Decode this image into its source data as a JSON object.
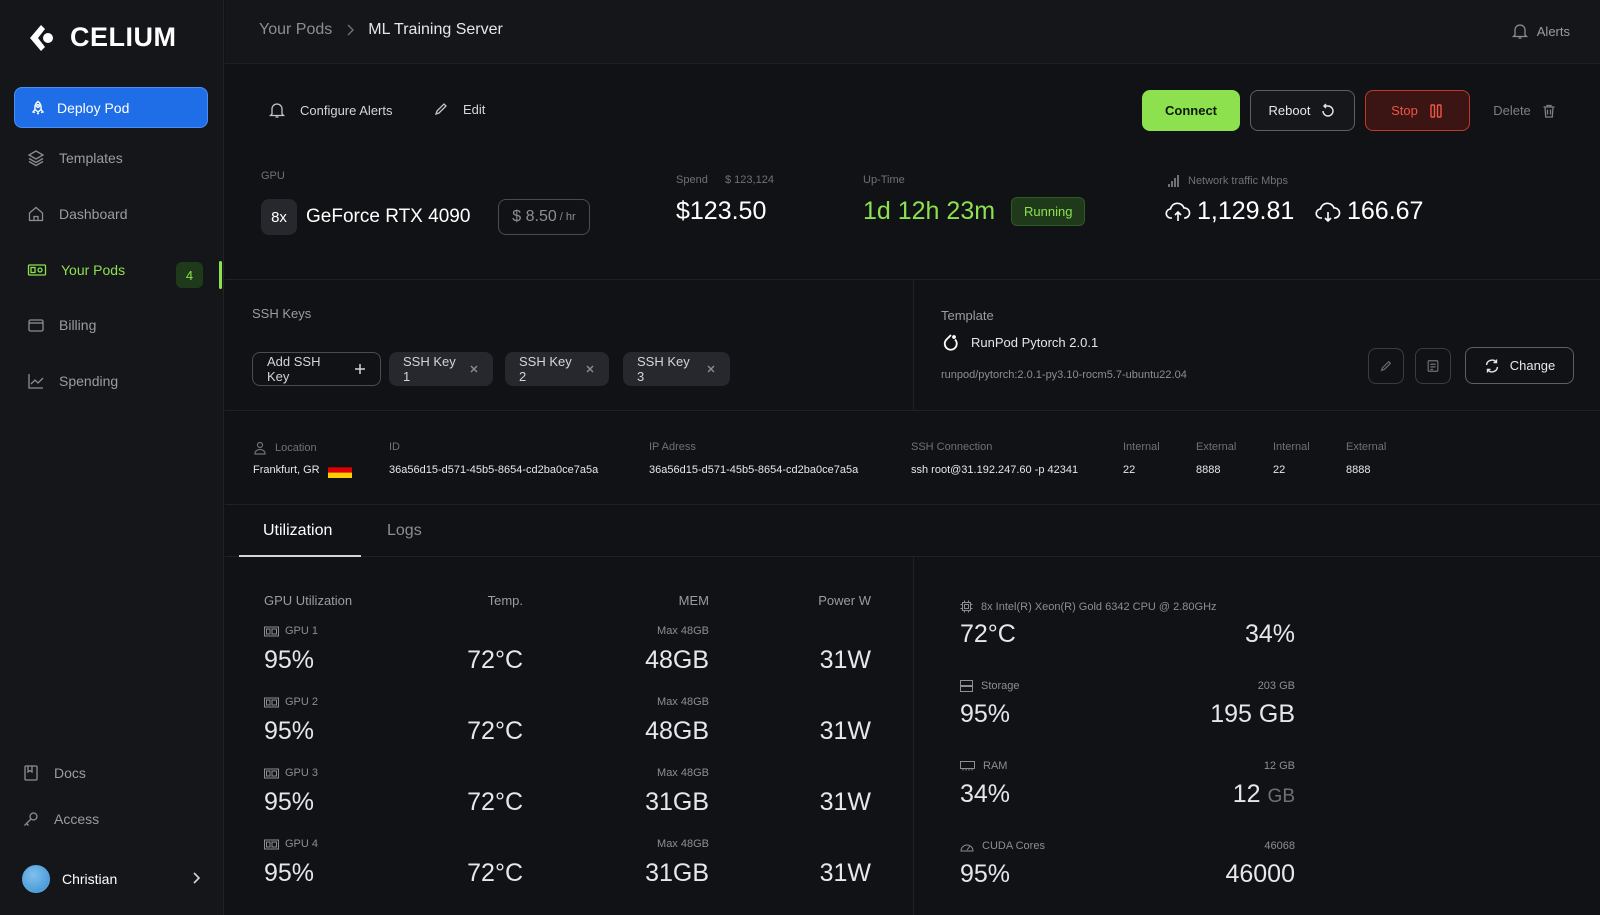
{
  "app": {
    "brand": "CELIUM"
  },
  "sidebar": {
    "deploy_label": "Deploy Pod",
    "items": [
      {
        "label": "Templates",
        "icon": "layers-icon"
      },
      {
        "label": "Dashboard",
        "icon": "home-icon"
      },
      {
        "label": "Your Pods",
        "icon": "gpu-icon",
        "badge": "4",
        "active": true
      },
      {
        "label": "Billing",
        "icon": "wallet-icon"
      },
      {
        "label": "Spending",
        "icon": "chart-icon"
      }
    ],
    "bottom": [
      {
        "label": "Docs",
        "icon": "book-icon"
      },
      {
        "label": "Access",
        "icon": "key-icon"
      }
    ],
    "user": {
      "name": "Christian"
    }
  },
  "header": {
    "breadcrumb": [
      "Your Pods",
      "ML Training Server"
    ],
    "alerts_label": "Alerts"
  },
  "actions": {
    "configure_alerts": "Configure Alerts",
    "edit": "Edit",
    "connect": "Connect",
    "reboot": "Reboot",
    "stop": "Stop",
    "delete": "Delete"
  },
  "stats": {
    "gpu_label": "GPU",
    "gpu_count": "8x",
    "gpu_name": "GeForce RTX 4090",
    "price": "$ 8.50",
    "price_unit": "/ hr",
    "spend_label": "Spend",
    "spend_total": "$ 123,124",
    "spend_value": "$123.50",
    "uptime_label": "Up-Time",
    "uptime_value": "1d 12h 23m",
    "status": "Running",
    "network_label": "Network traffic Mbps",
    "upload": "1,129.81",
    "download": "166.67"
  },
  "ssh": {
    "title": "SSH Keys",
    "add_label": "Add SSH Key",
    "keys": [
      "SSH Key 1",
      "SSH Key 2",
      "SSH Key 3"
    ]
  },
  "template": {
    "title": "Template",
    "name": "RunPod Pytorch 2.0.1",
    "image": "runpod/pytorch:2.0.1-py3.10-rocm5.7-ubuntu22.04",
    "change_label": "Change"
  },
  "info": {
    "location_label": "Location",
    "location": "Frankfurt, GR",
    "id_label": "ID",
    "id": "36a56d15-d571-45b5-8654-cd2ba0ce7a5a",
    "ip_label": "IP Adress",
    "ip": "36a56d15-d571-45b5-8654-cd2ba0ce7a5a",
    "ssh_label": "SSH Connection",
    "ssh": "ssh root@31.192.247.60 -p 42341",
    "ports": [
      {
        "label": "Internal",
        "value": "22"
      },
      {
        "label": "External",
        "value": "8888"
      },
      {
        "label": "Internal",
        "value": "22"
      },
      {
        "label": "External",
        "value": "8888"
      }
    ]
  },
  "tabs": [
    "Utilization",
    "Logs"
  ],
  "utilization": {
    "headers": [
      "GPU Utilization",
      "Temp.",
      "MEM",
      "Power W"
    ],
    "gpus": [
      {
        "name": "GPU 1",
        "util": "95%",
        "temp": "72°C",
        "max": "Max 48GB",
        "mem": "48GB",
        "power": "31W"
      },
      {
        "name": "GPU 2",
        "util": "95%",
        "temp": "72°C",
        "max": "Max 48GB",
        "mem": "48GB",
        "power": "31W"
      },
      {
        "name": "GPU 3",
        "util": "95%",
        "temp": "72°C",
        "max": "Max 48GB",
        "mem": "31GB",
        "power": "31W"
      },
      {
        "name": "GPU 4",
        "util": "95%",
        "temp": "72°C",
        "max": "Max 48GB",
        "mem": "31GB",
        "power": "31W"
      }
    ],
    "cpu": {
      "label": "8x Intel(R) Xeon(R) Gold 6342 CPU @ 2.80GHz",
      "temp": "72°C",
      "usage": "34%"
    },
    "storage": {
      "label": "Storage",
      "total": "203 GB",
      "percent": "95%",
      "used": "195 GB"
    },
    "ram": {
      "label": "RAM",
      "total": "12 GB",
      "percent": "34%",
      "used_num": "12",
      "used_unit": "GB"
    },
    "cuda": {
      "label": "CUDA Cores",
      "total": "46068",
      "percent": "95%",
      "used": "46000"
    }
  },
  "colors": {
    "accent": "#8de04e",
    "primary": "#1f6ee8",
    "danger": "#f05545",
    "bg": "#111215"
  }
}
